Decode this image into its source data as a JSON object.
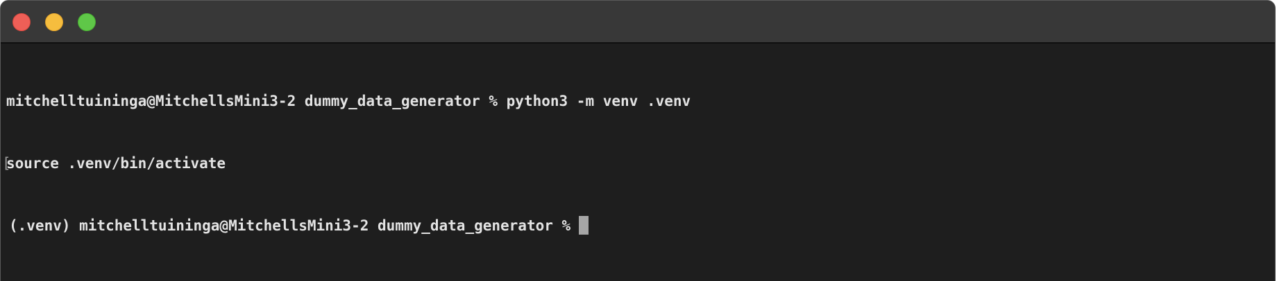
{
  "window": {
    "controls": {
      "close": "close",
      "minimize": "minimize",
      "zoom": "zoom"
    }
  },
  "terminal": {
    "lines": [
      "mitchelltuininga@MitchellsMini3-2 dummy_data_generator % python3 -m venv .venv",
      "source .venv/bin/activate",
      "(.venv) mitchelltuininga@MitchellsMini3-2 dummy_data_generator %"
    ],
    "bracket_glyph": "[",
    "cursor": "block"
  },
  "colors": {
    "background": "#1e1e1e",
    "titlebar": "#383838",
    "text": "#e3e3e3",
    "cursor": "#a6a6a6",
    "close": "#ee5f57",
    "minimize": "#f6bd3e",
    "zoom": "#5fc748"
  }
}
